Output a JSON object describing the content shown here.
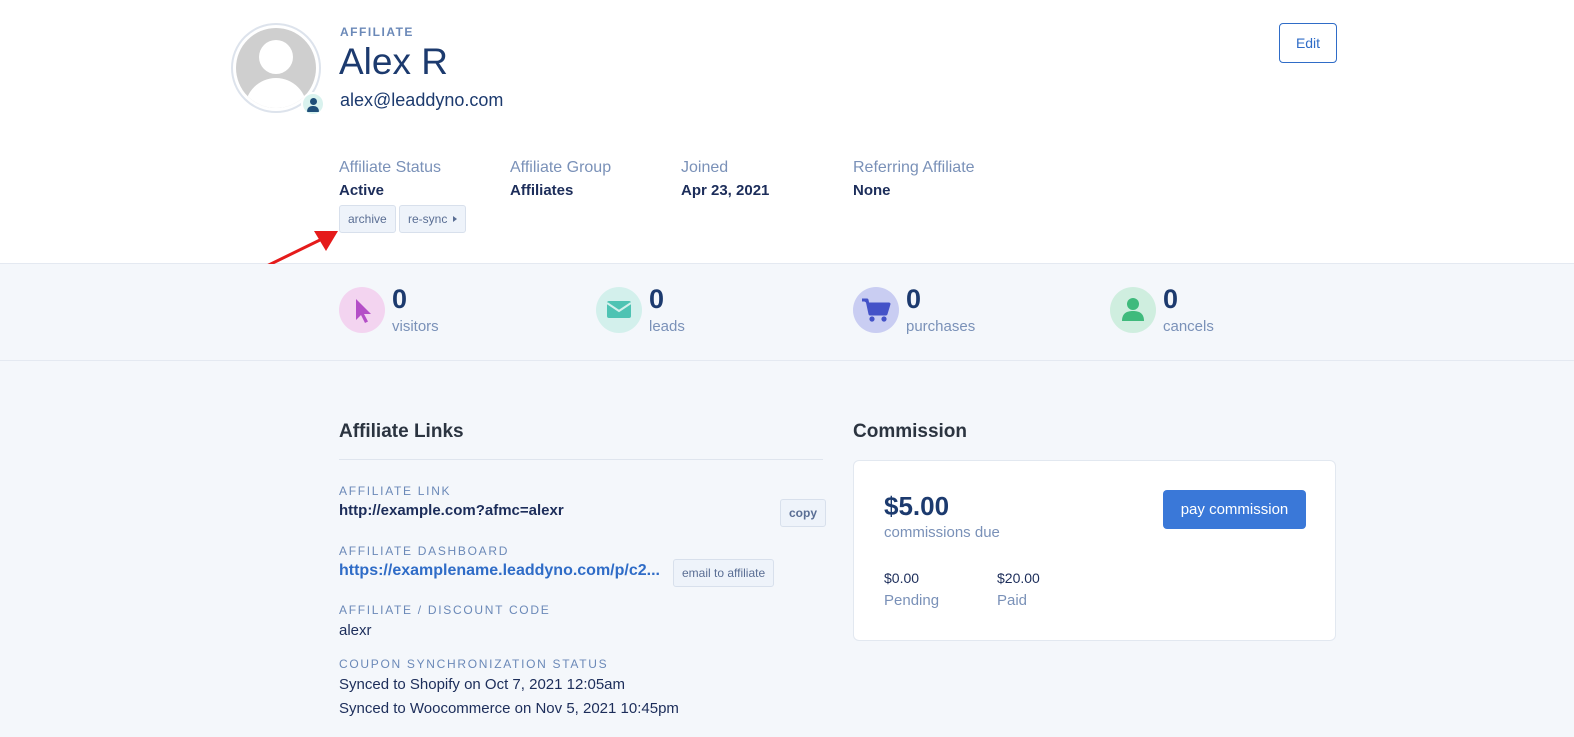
{
  "header": {
    "role": "AFFILIATE",
    "name": "Alex R",
    "email": "alex@leaddyno.com",
    "edit_label": "Edit"
  },
  "meta": [
    {
      "label": "Affiliate Status",
      "value": "Active"
    },
    {
      "label": "Affiliate Group",
      "value": "Affiliates"
    },
    {
      "label": "Joined",
      "value": "Apr 23, 2021"
    },
    {
      "label": "Referring Affiliate",
      "value": "None"
    }
  ],
  "status_actions": {
    "archive": "archive",
    "resync": "re-sync"
  },
  "stats": [
    {
      "value": "0",
      "label": "visitors",
      "icon": "cursor-icon",
      "bg": "#f3d4f0",
      "color": "#b44fc7"
    },
    {
      "value": "0",
      "label": "leads",
      "icon": "envelope-icon",
      "bg": "#d3f0ec",
      "color": "#4ec3b3"
    },
    {
      "value": "0",
      "label": "purchases",
      "icon": "cart-icon",
      "bg": "#c9cdf2",
      "color": "#4452c8"
    },
    {
      "value": "0",
      "label": "cancels",
      "icon": "person-icon",
      "bg": "#cfeedf",
      "color": "#3fba7c"
    }
  ],
  "affiliate_links": {
    "title": "Affiliate Links",
    "link_label": "AFFILIATE LINK",
    "link_value": "http://example.com?afmc=alexr",
    "copy_label": "copy",
    "dashboard_label": "AFFILIATE DASHBOARD",
    "dashboard_value": "https://examplename.leaddyno.com/p/c2...",
    "email_label": "email to affiliate",
    "code_label": "AFFILIATE / DISCOUNT CODE",
    "code_value": "alexr",
    "sync_label": "COUPON SYNCHRONIZATION STATUS",
    "sync_lines": [
      "Synced to Shopify on Oct 7, 2021 12:05am",
      "Synced to Woocommerce on Nov 5, 2021 10:45pm"
    ]
  },
  "commission": {
    "title": "Commission",
    "due_amount": "$5.00",
    "due_label": "commissions due",
    "pay_label": "pay commission",
    "pending_amount": "$0.00",
    "pending_label": "Pending",
    "paid_amount": "$20.00",
    "paid_label": "Paid"
  }
}
